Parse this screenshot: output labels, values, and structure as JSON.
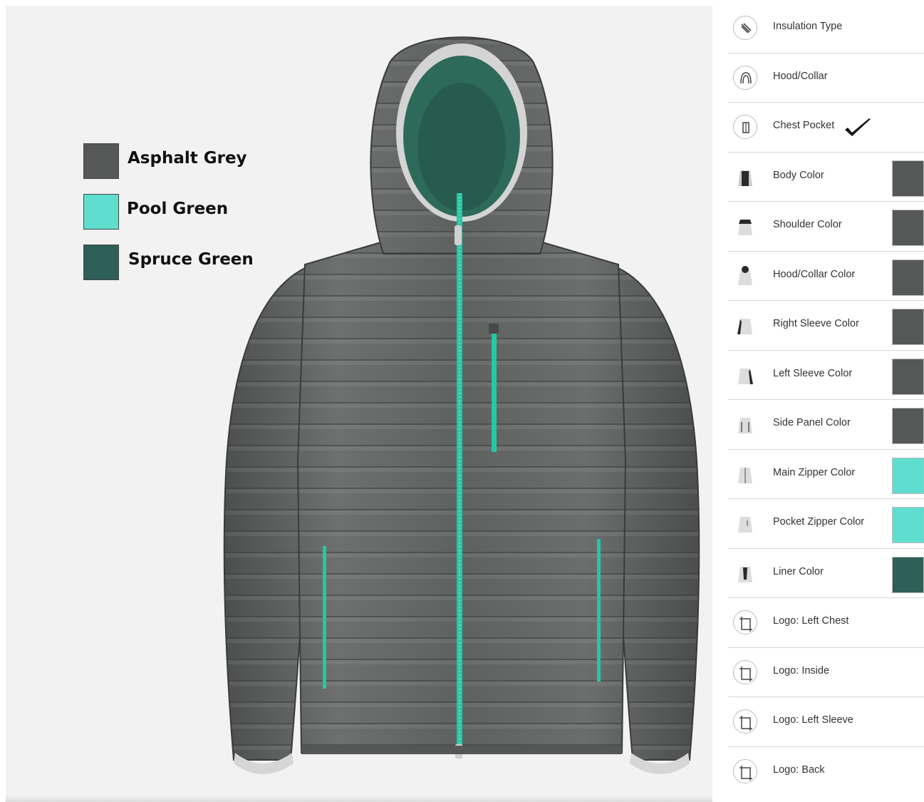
{
  "legend": [
    {
      "name": "Asphalt Grey",
      "color": "#565858"
    },
    {
      "name": "Pool Green",
      "color": "#5fded0"
    },
    {
      "name": "Spruce Green",
      "color": "#2e5f58"
    }
  ],
  "options": [
    {
      "label": "Insulation Type",
      "icon": "feather-icon"
    },
    {
      "label": "Hood/Collar",
      "icon": "hood-icon"
    },
    {
      "label": "Chest Pocket",
      "icon": "pocket-icon",
      "checked": true
    },
    {
      "label": "Body Color",
      "icon": "jacket-body-icon",
      "swatch": "#565858"
    },
    {
      "label": "Shoulder Color",
      "icon": "jacket-shoulder-icon",
      "swatch": "#565858"
    },
    {
      "label": "Hood/Collar Color",
      "icon": "jacket-hood-icon",
      "swatch": "#565858"
    },
    {
      "label": "Right Sleeve Color",
      "icon": "jacket-right-sleeve-icon",
      "swatch": "#565858"
    },
    {
      "label": "Left Sleeve Color",
      "icon": "jacket-left-sleeve-icon",
      "swatch": "#565858"
    },
    {
      "label": "Side Panel Color",
      "icon": "jacket-side-panel-icon",
      "swatch": "#565858"
    },
    {
      "label": "Main Zipper Color",
      "icon": "jacket-main-zipper-icon",
      "swatch": "#5fded0"
    },
    {
      "label": "Pocket Zipper Color",
      "icon": "jacket-pocket-zipper-icon",
      "swatch": "#5fded0"
    },
    {
      "label": "Liner Color",
      "icon": "jacket-liner-icon",
      "swatch": "#2e5f58"
    },
    {
      "label": "Logo: Left Chest",
      "icon": "crop-icon"
    },
    {
      "label": "Logo: Inside",
      "icon": "crop-icon"
    },
    {
      "label": "Logo: Left Sleeve",
      "icon": "crop-icon"
    },
    {
      "label": "Logo: Back",
      "icon": "crop-icon"
    }
  ]
}
